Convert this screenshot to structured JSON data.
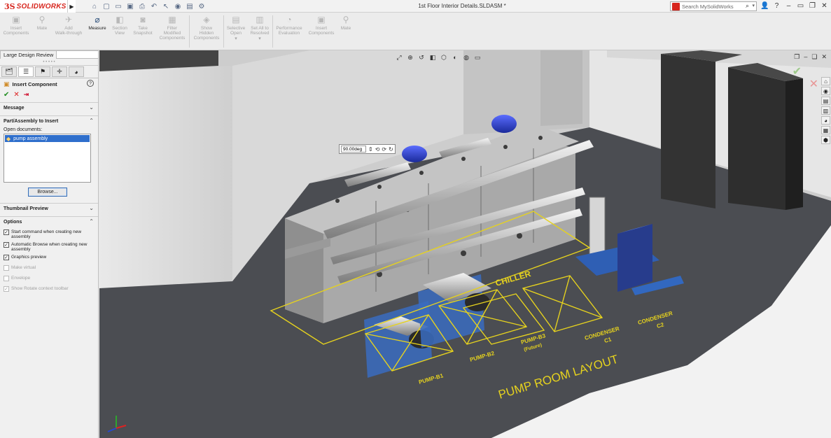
{
  "app": {
    "logo_ds": "3S",
    "logo_brand": "SOLIDWORKS",
    "document_title": "1st Floor Interior Details.SLDASM *"
  },
  "search": {
    "placeholder": "Search MySolidWorks"
  },
  "commands": [
    {
      "label": "Insert\nComponents",
      "active": false
    },
    {
      "label": "Mate",
      "active": false
    },
    {
      "label": "Add\nWalk-through",
      "active": false
    },
    {
      "label": "Measure",
      "active": true
    },
    {
      "label": "Section\nView",
      "active": false
    },
    {
      "label": "Take\nSnapshot",
      "active": false
    },
    {
      "label": "Filter\nModified\nComponents",
      "active": false
    },
    {
      "label": "Show\nHidden\nComponents",
      "active": false
    },
    {
      "label": "Selective\nOpen",
      "active": false
    },
    {
      "label": "Set All to\nResolved",
      "active": false
    },
    {
      "label": "Performance\nEvaluation",
      "active": false
    },
    {
      "label": "Insert\nComponents",
      "active": false
    },
    {
      "label": "Mate",
      "active": false
    }
  ],
  "left_panel": {
    "tab_label": "Large Design Review",
    "pm_title": "Insert Component",
    "sections": {
      "message": "Message",
      "part_assembly": "Part/Assembly to Insert",
      "open_documents_label": "Open documents:",
      "thumbnail": "Thumbnail Preview",
      "options": "Options"
    },
    "open_documents": [
      "pump assembly"
    ],
    "browse_label": "Browse...",
    "options": [
      {
        "label": "Start command when creating new assembly",
        "checked": true,
        "enabled": true
      },
      {
        "label": "Automatic Browse when creating new assembly",
        "checked": true,
        "enabled": true
      },
      {
        "label": "Graphics preview",
        "checked": true,
        "enabled": true
      },
      {
        "label": "Make virtual",
        "checked": false,
        "enabled": false
      },
      {
        "label": "Envelope",
        "checked": false,
        "enabled": false
      },
      {
        "label": "Show Rotate context toolbar",
        "checked": true,
        "enabled": false
      }
    ]
  },
  "viewport": {
    "angle_value": "90.00deg",
    "labels": {
      "chiller": "CHILLER",
      "pump_b1": "PUMP-B1",
      "pump_b2": "PUMP-B2",
      "pump_b3_line1": "PUMP-B3",
      "pump_b3_line2": "(Future)",
      "condenser_c1_line1": "CONDENSER",
      "condenser_c1_line2": "C1",
      "condenser_c2_line1": "CONDENSER",
      "condenser_c2_line2": "C2",
      "layout_title": "PUMP ROOM LAYOUT"
    }
  },
  "icons": {
    "titlebar": [
      "home-icon",
      "new-icon",
      "open-icon",
      "save-icon",
      "print-icon",
      "undo-icon",
      "select-icon",
      "rebuild-icon",
      "file-props-icon",
      "options-icon"
    ],
    "window": [
      "user-icon",
      "help-icon",
      "pin-icon",
      "minimize-icon",
      "restore-icon",
      "close-icon"
    ]
  },
  "colors": {
    "accent_red": "#d7261e",
    "selection_blue": "#2f6fcc",
    "layout_yellow": "#e6d21e",
    "floor": "#4b4d52"
  }
}
